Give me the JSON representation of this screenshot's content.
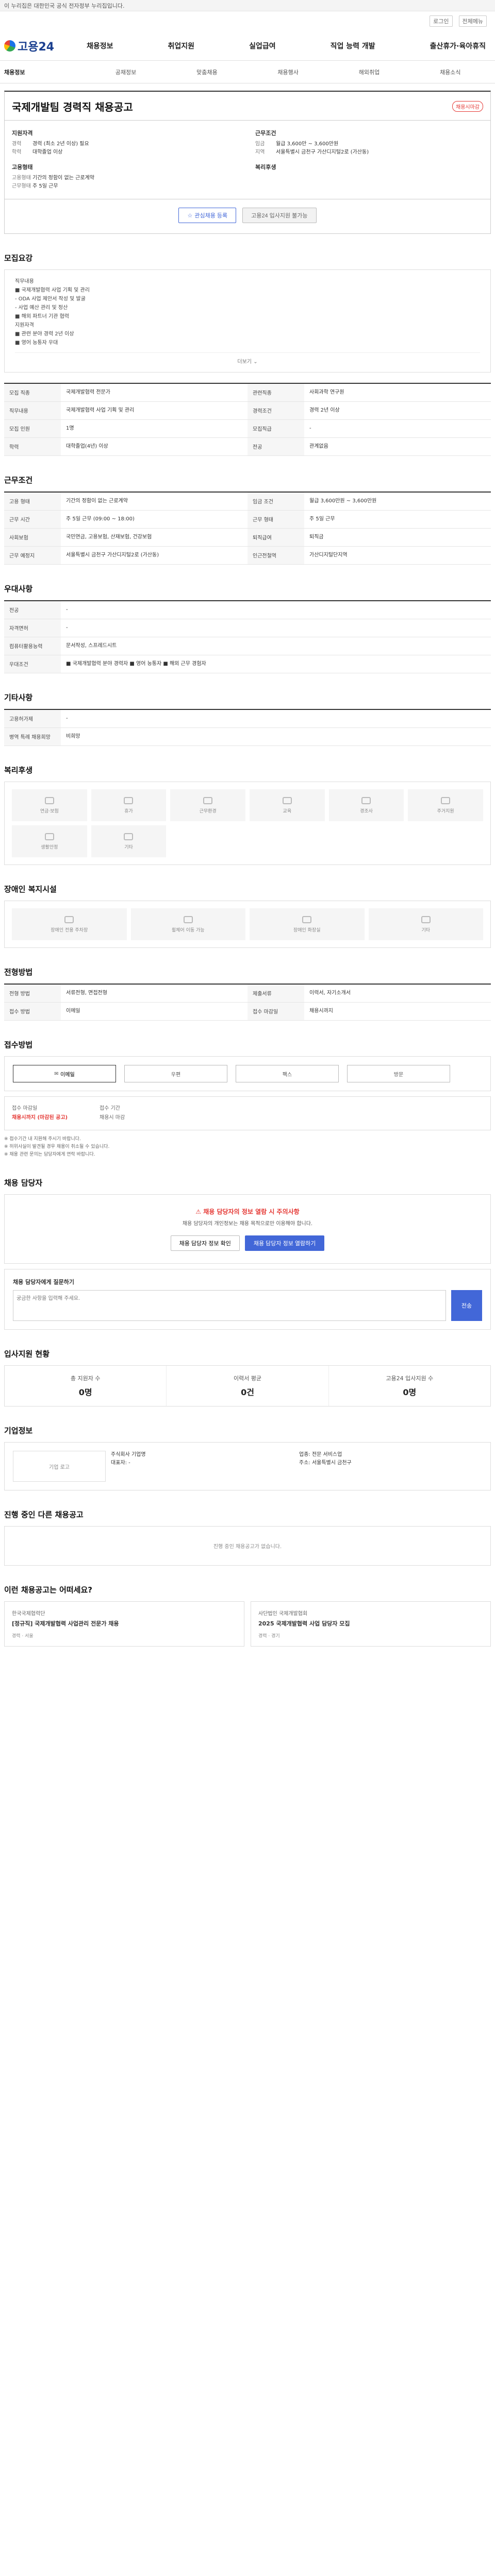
{
  "banner": "이 누리집은 대한민국 공식 전자정부 누리집입니다.",
  "util": {
    "login": "로그인",
    "menu": "전체메뉴"
  },
  "logo": "고용24",
  "gnb": [
    "채용정보",
    "취업지원",
    "실업급여",
    "직업 능력 개발",
    "출산휴가·육아휴직"
  ],
  "lnb": [
    "채용정보",
    "공채정보",
    "맞춤채용",
    "채용행사",
    "해외취업",
    "채용소식"
  ],
  "job": {
    "title": "국제개발팀 경력직 채용공고",
    "badge": "채용시마감",
    "left_title": "지원자격",
    "left": [
      {
        "k": "경력",
        "v": "경력 (최소 2년 이상) 필요"
      },
      {
        "k": "학력",
        "v": "대학졸업 이상"
      }
    ],
    "right_title": "근무조건",
    "right": [
      {
        "k": "임금",
        "v": "월급 3,600만 ~ 3,600만원"
      },
      {
        "k": "지역",
        "v": "서울특별시 금천구 가산디지털2로 (가산동)"
      }
    ],
    "corp_title": "고용형태",
    "corp": [
      {
        "k": "고용형태",
        "v": "기간의 정함이 없는 근로계약"
      },
      {
        "k": "근무형태",
        "v": "주 5일 근무"
      }
    ],
    "corp2_title": "복리후생",
    "buttons": {
      "scrap": "관심채용 등록",
      "apply": "고용24 입사지원 불가능"
    }
  },
  "sec_recruit": {
    "title": "모집요강",
    "lines": [
      "직무내용",
      "■ 국제개발협력 사업 기획 및 관리",
      "- ODA 사업 제안서 작성 및 발굴",
      "- 사업 예산 관리 및 정산",
      "■ 해외 파트너 기관 협력",
      "지원자격",
      "■ 관련 분야 경력 2년 이상",
      "■ 영어 능통자 우대"
    ],
    "more": "더보기"
  },
  "table1": [
    {
      "k": "모집 직종",
      "v": "국제개발협력 전문가",
      "k2": "관련직종",
      "v2": "사회과학 연구원"
    },
    {
      "k": "직무내용",
      "v": "국제개발협력 사업 기획 및 관리",
      "k2": "경력조건",
      "v2": "경력 2년 이상"
    },
    {
      "k": "모집 인원",
      "v": "1명",
      "k2": "모집직급",
      "v2": "-"
    },
    {
      "k": "학력",
      "v": "대학졸업(4년) 이상",
      "k2": "전공",
      "v2": "관계없음"
    }
  ],
  "sec_cond": {
    "title": "근무조건"
  },
  "table2": [
    {
      "k": "고용 형태",
      "v": "기간의 정함이 없는 근로계약",
      "k2": "임금 조건",
      "v2": "월급 3,600만원 ~ 3,600만원"
    },
    {
      "k": "근무 시간",
      "v": "주 5일 근무 (09:00 ~ 18:00)",
      "k2": "근무 형태",
      "v2": "주 5일 근무"
    },
    {
      "k": "사회보험",
      "v": "국민연금, 고용보험, 산재보험, 건강보험",
      "k2": "퇴직급여",
      "v2": "퇴직금"
    },
    {
      "k": "근무 예정지",
      "v": "서울특별시 금천구 가산디지털2로 (가산동)",
      "k2": "인근전철역",
      "v2": "가산디지털단지역"
    }
  ],
  "sec_welfare": {
    "title": "우대사항"
  },
  "table3": [
    {
      "k": "전공",
      "v": "-"
    },
    {
      "k": "자격면허",
      "v": "-"
    },
    {
      "k": "컴퓨터활용능력",
      "v": "문서작성, 스프레드시트"
    },
    {
      "k": "우대조건",
      "v": "■ 국제개발협력 분야 경력자 ■ 영어 능통자 ■ 해외 근무 경험자"
    }
  ],
  "sec_etc": {
    "title": "기타사항"
  },
  "table4": [
    {
      "k": "고용허가제",
      "v": "-"
    },
    {
      "k": "병역 특례 채용희망",
      "v": "비희망"
    }
  ],
  "sec_benefit": {
    "title": "복리후생",
    "items": [
      "연금·보험",
      "휴가",
      "근무환경",
      "교육",
      "경조사",
      "주거지원",
      "생활안정",
      "기타"
    ]
  },
  "sec_disabled": {
    "title": "장애인 복지시설",
    "items": [
      "장애인 전용 주차장",
      "휠체어 이동 가능",
      "장애인 화장실",
      "기타"
    ]
  },
  "sec_process": {
    "title": "전형방법"
  },
  "table5": [
    {
      "k": "전형 방법",
      "v": "서류전형, 면접전형",
      "k2": "제출서류",
      "v2": "이력서, 자기소개서"
    },
    {
      "k": "접수 방법",
      "v": "이메일",
      "k2": "접수 마감일",
      "v2": "채용시까지"
    }
  ],
  "sec_apply": {
    "title": "접수방법",
    "opts": [
      "이메일",
      "우편",
      "팩스",
      "방문"
    ],
    "deadline_label": "접수 마감일",
    "deadline_val": "채용시까지 (마감된 공고)",
    "period_label": "접수 기간",
    "period_val": "채용시 마감",
    "bullets": [
      "※ 접수기간 내 지원해 주시기 바랍니다.",
      "※ 허위사실이 발견될 경우 채용이 취소될 수 있습니다.",
      "※ 채용 관련 문의는 담당자에게 연락 바랍니다."
    ]
  },
  "sec_contact": {
    "title": "채용 담당자",
    "alert": "채용 담당자의 정보 열람 시 주의사항",
    "msg": "채용 담당자의 개인정보는 채용 목적으로만 이용해야 합니다.",
    "btn1": "채용 담당자 정보 확인",
    "btn2": "채용 담당자 정보 열람하기"
  },
  "report": {
    "title": "채용 담당자에게 질문하기",
    "placeholder": "궁금한 사항을 입력해 주세요.",
    "send": "전송"
  },
  "sec_stats": {
    "title": "입사지원 현황",
    "items": [
      {
        "n": "총 지원자 수",
        "c": "0명"
      },
      {
        "n": "이력서 평균",
        "c": "0건"
      },
      {
        "n": "고용24 입사지원 수",
        "c": "0명"
      }
    ]
  },
  "sec_company": {
    "title": "기업정보",
    "logo": "기업 로고",
    "name": "주식회사 기업명",
    "rep": "대표자: -",
    "type": "업종: 전문 서비스업",
    "addr": "주소: 서울특별시 금천구"
  },
  "sec_other": {
    "title": "진행 중인 다른 채용공고",
    "empty": "진행 중인 채용공고가 없습니다."
  },
  "sec_rec": {
    "title": "이런 채용공고는 어떠세요?",
    "items": [
      {
        "co": "한국국제협력단",
        "tt": "[정규직] 국제개발협력 사업관리 전문가 채용",
        "meta": "경력 · 서울"
      },
      {
        "co": "사단법인 국제개발협회",
        "tt": "2025 국제개발협력 사업 담당자 모집",
        "meta": "경력 · 경기"
      }
    ]
  }
}
